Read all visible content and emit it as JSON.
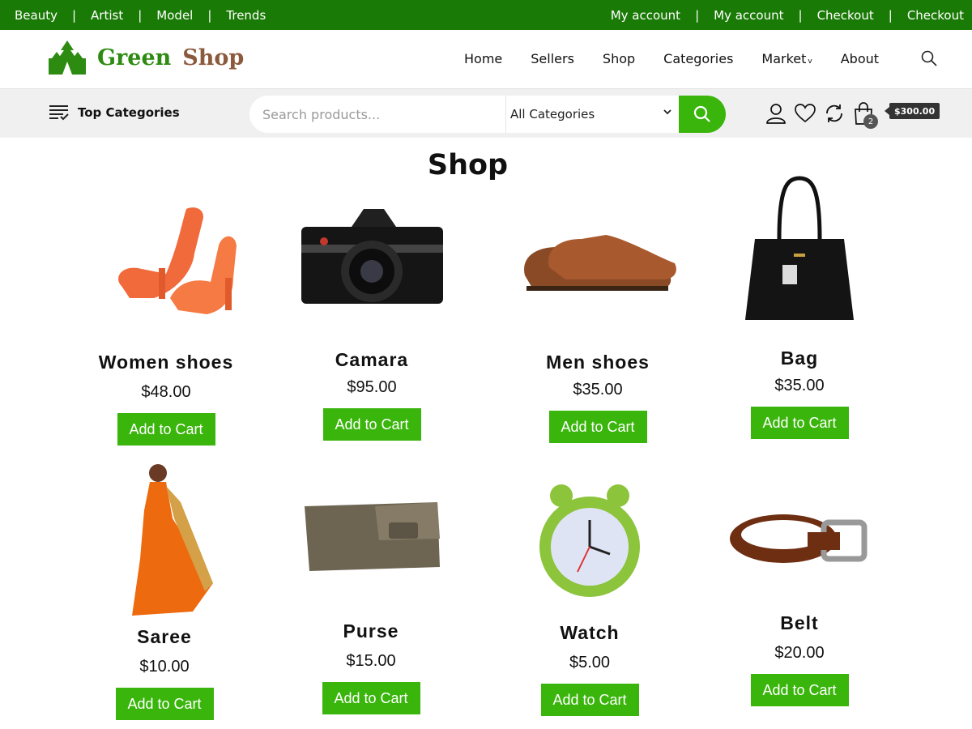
{
  "topbar": {
    "left_links": [
      "Beauty",
      "Artist",
      "Model",
      "Trends"
    ],
    "right_links": [
      "My account",
      "My account",
      "Checkout",
      "Checkout"
    ],
    "separator": "|"
  },
  "header": {
    "logo_green": "Green",
    "logo_brown": "Shop",
    "nav": [
      {
        "label": "Home"
      },
      {
        "label": "Sellers"
      },
      {
        "label": "Shop"
      },
      {
        "label": "Categories"
      },
      {
        "label": "Market",
        "caret": "v"
      },
      {
        "label": "About"
      }
    ]
  },
  "catbar": {
    "top_categories": "Top Categories",
    "search_placeholder": "Search products...",
    "category_select": "All Categories",
    "cart_count": "2",
    "cart_total": "$300.00"
  },
  "page": {
    "title": "Shop"
  },
  "colors": {
    "topbar": "#1a7a06",
    "accent": "#3ab50c",
    "logo_green": "#2e8b12",
    "logo_brown": "#8b5a3c"
  },
  "products": [
    {
      "name": "Women shoes",
      "price": "$48.00",
      "button": "Add to Cart"
    },
    {
      "name": "Camara",
      "price": "$95.00",
      "button": "Add to Cart"
    },
    {
      "name": "Men shoes",
      "price": "$35.00",
      "button": "Add to Cart"
    },
    {
      "name": "Bag",
      "price": "$35.00",
      "button": "Add to Cart"
    },
    {
      "name": "Saree",
      "price": "$10.00",
      "button": "Add to Cart"
    },
    {
      "name": "Purse",
      "price": "$15.00",
      "button": "Add to Cart"
    },
    {
      "name": "Watch",
      "price": "$5.00",
      "button": "Add to Cart"
    },
    {
      "name": "Belt",
      "price": "$20.00",
      "button": "Add to Cart"
    }
  ]
}
